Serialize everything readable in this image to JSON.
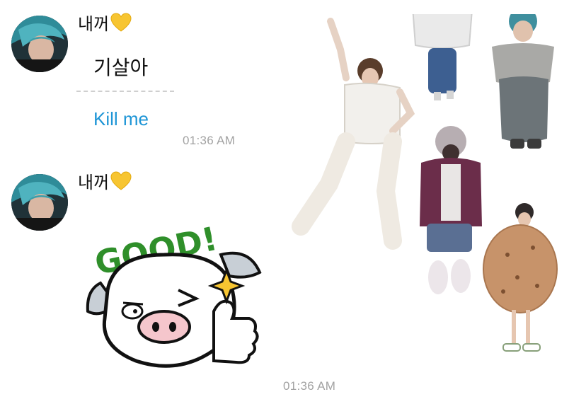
{
  "messages": [
    {
      "sender": "내꺼",
      "sender_emoji": "yellow-heart-icon",
      "text": "기살아",
      "translation": "Kill me",
      "time": "01:36 AM"
    },
    {
      "sender": "내꺼",
      "sender_emoji": "yellow-heart-icon",
      "sticker_text": "GOOD!",
      "time": "01:36 AM"
    }
  ],
  "colors": {
    "translation": "#1e95d6",
    "timestamp": "#a2a2a2",
    "heart": "#f7c531",
    "sticker_green": "#2f8f2a"
  }
}
